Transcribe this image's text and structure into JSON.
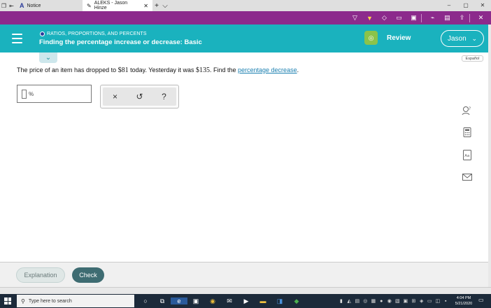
{
  "browser": {
    "tabs": [
      {
        "label": "Notice",
        "active": false
      },
      {
        "label": "ALEKS - Jason Hinze",
        "active": true
      }
    ],
    "new_tab": "+",
    "tab_menu": "⌵",
    "window_controls": [
      "–",
      "▢",
      "✕"
    ]
  },
  "header": {
    "menu_icon": "hamburger-icon",
    "topic": "RATIOS, PROPORTIONS, AND PERCENTS",
    "title": "Finding the percentage increase or decrease: Basic",
    "review_label": "Review",
    "user_label": "Jason"
  },
  "language_label": "Español",
  "question": {
    "text_before": "The price of an item has dropped to ",
    "value_now": "$81",
    "text_mid": " today. Yesterday it was ",
    "value_before": "$135",
    "text_after": ". Find the ",
    "link": "percentage decrease",
    "end": "."
  },
  "answer": {
    "value": "",
    "unit": "%"
  },
  "keypad": {
    "clear": "×",
    "undo": "↺",
    "help": "?"
  },
  "side_tools": [
    "person-help-icon",
    "calculator-icon",
    "dictionary-icon",
    "mail-icon"
  ],
  "footer": {
    "explanation_label": "Explanation",
    "check_label": "Check"
  },
  "taskbar": {
    "search_placeholder": "Type here to search",
    "time": "4:04 PM",
    "date": "5/21/2020"
  },
  "colors": {
    "header": "#1ab2be",
    "toolbar": "#8c2a8c",
    "check_button": "#3e6c72",
    "link": "#1a7fb0",
    "badge": "#8bc34a"
  }
}
